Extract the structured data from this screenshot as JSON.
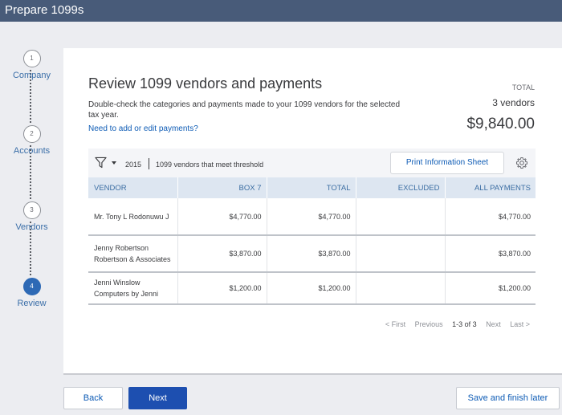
{
  "window": {
    "title": "Prepare 1099s"
  },
  "steps": [
    {
      "number": "1",
      "label": "Company",
      "active": false
    },
    {
      "number": "2",
      "label": "Accounts",
      "active": false
    },
    {
      "number": "3",
      "label": "Vendors",
      "active": false
    },
    {
      "number": "4",
      "label": "Review",
      "active": true
    }
  ],
  "main": {
    "title": "Review 1099 vendors and payments",
    "description": "Double-check the categories and payments made to your 1099 vendors for the selected tax year.",
    "help_link": "Need to add or edit payments?"
  },
  "summary": {
    "label": "TOTAL",
    "count": "3 vendors",
    "amount": "$9,840.00"
  },
  "toolbar": {
    "year": "2015",
    "filter_label": "1099 vendors that meet threshold",
    "print_label": "Print Information Sheet"
  },
  "table": {
    "headers": [
      "VENDOR",
      "BOX 7",
      "TOTAL",
      "EXCLUDED",
      "ALL PAYMENTS"
    ],
    "rows": [
      {
        "vendor_line1": "Mr. Tony L Rodonuwu J",
        "vendor_line2": "",
        "box7": "$4,770.00",
        "total": "$4,770.00",
        "excluded": "",
        "all_payments": "$4,770.00"
      },
      {
        "vendor_line1": "Jenny Robertson",
        "vendor_line2": "Robertson & Associates",
        "box7": "$3,870.00",
        "total": "$3,870.00",
        "excluded": "",
        "all_payments": "$3,870.00"
      },
      {
        "vendor_line1": "Jenni Winslow",
        "vendor_line2": "Computers by Jenni",
        "box7": "$1,200.00",
        "total": "$1,200.00",
        "excluded": "",
        "all_payments": "$1,200.00"
      }
    ]
  },
  "pagination": {
    "first": "< First",
    "previous": "Previous",
    "range": "1-3 of 3",
    "next": "Next",
    "last": "Last >"
  },
  "footer": {
    "back_label": "Back",
    "next_label": "Next",
    "save_later_label": "Save and finish later"
  },
  "colors": {
    "header_bar": "#485b79",
    "accent": "#1d4fb0",
    "link": "#0d5bb5",
    "table_header": "#dde6f1"
  }
}
